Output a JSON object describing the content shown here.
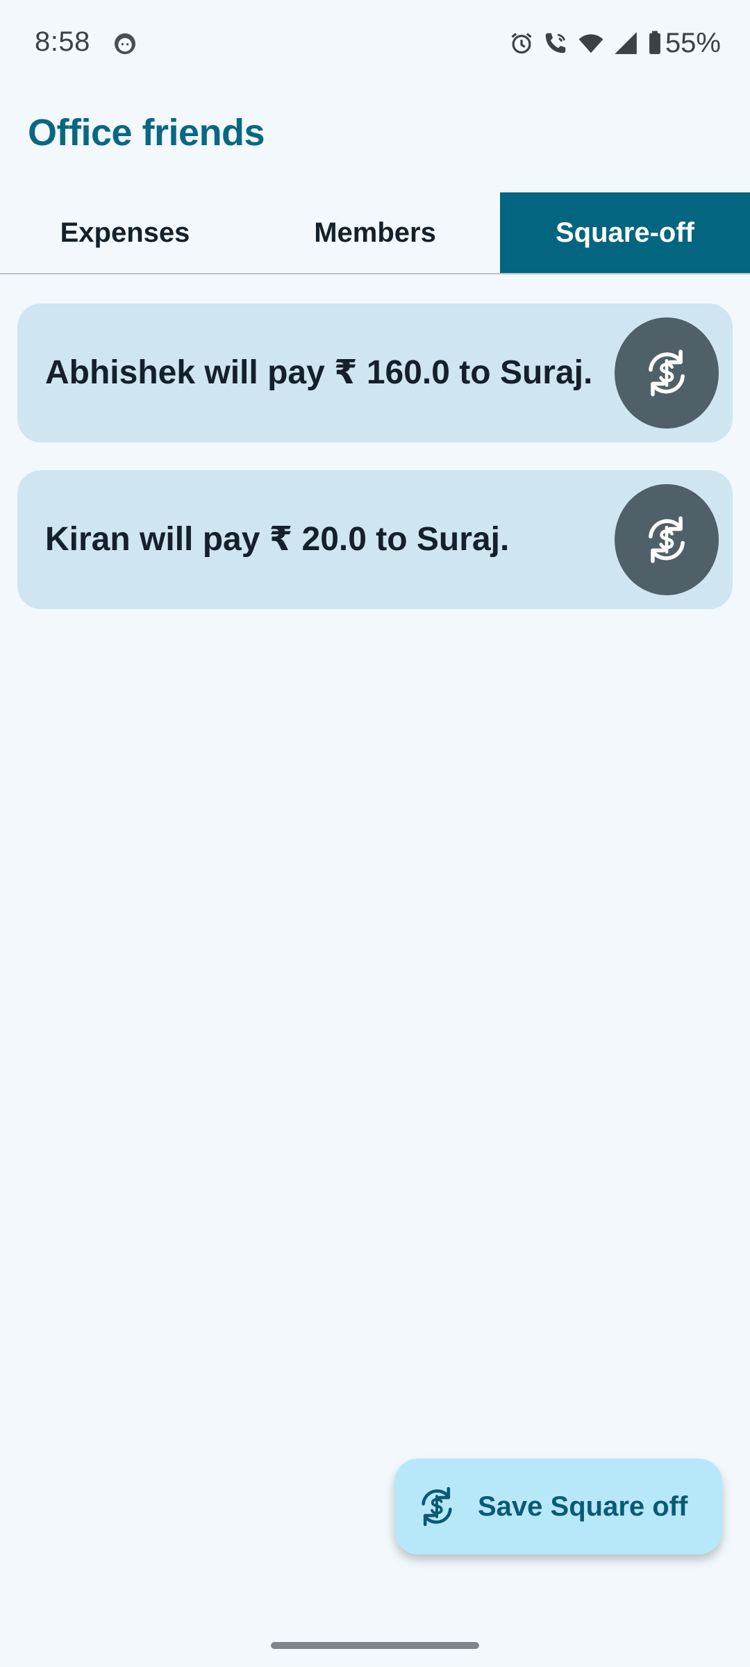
{
  "status_bar": {
    "time": "8:58",
    "battery": "55%",
    "icons": [
      "face-icon",
      "alarm-icon",
      "wifi-calling-icon",
      "wifi-icon",
      "cell-signal-icon",
      "battery-icon"
    ]
  },
  "header": {
    "title": "Office friends"
  },
  "tabs": [
    {
      "label": "Expenses",
      "selected": false
    },
    {
      "label": "Members",
      "selected": false
    },
    {
      "label": "Square-off",
      "selected": true
    }
  ],
  "settlements": [
    {
      "text": "Abhishek will pay ₹ 160.0 to Suraj.",
      "icon": "currency-exchange-icon"
    },
    {
      "text": "Kiran will pay ₹ 20.0 to Suraj.",
      "icon": "currency-exchange-icon"
    }
  ],
  "fab": {
    "label": "Save Square off",
    "icon": "currency-exchange-icon"
  },
  "colors": {
    "primary": "#036580",
    "card_bg": "#cfe5f0",
    "action_bg": "#4f6068",
    "fab_bg": "#b7e8f9",
    "background": "#f2f8fc"
  }
}
